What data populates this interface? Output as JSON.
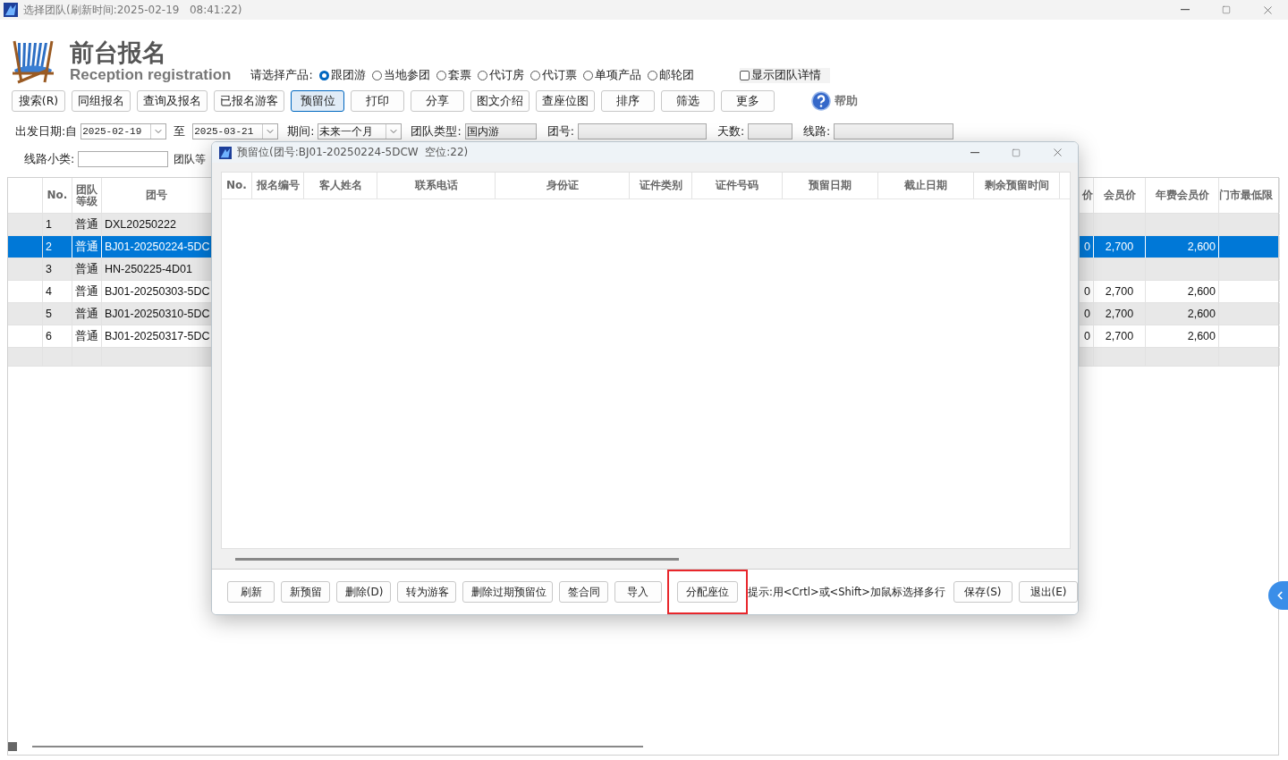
{
  "window": {
    "title": "选择团队(刷新时间:2025-02-19   08:41:22)"
  },
  "header": {
    "title": "前台报名",
    "subtitle": "Reception registration"
  },
  "product": {
    "label": "请选择产品:",
    "options": [
      {
        "label": "跟团游",
        "selected": true
      },
      {
        "label": "当地参团",
        "selected": false
      },
      {
        "label": "套票",
        "selected": false
      },
      {
        "label": "代订房",
        "selected": false
      },
      {
        "label": "代订票",
        "selected": false
      },
      {
        "label": "单项产品",
        "selected": false
      },
      {
        "label": "邮轮团",
        "selected": false
      }
    ],
    "detail_checkbox": {
      "label": "显示团队详情",
      "checked": false
    }
  },
  "toolbar": [
    {
      "label": "搜索(R)",
      "selected": false
    },
    {
      "label": "同组报名",
      "selected": false
    },
    {
      "label": "查询及报名",
      "selected": false
    },
    {
      "label": "已报名游客",
      "selected": false
    },
    {
      "label": "预留位",
      "selected": true
    },
    {
      "label": "打印",
      "selected": false
    },
    {
      "label": "分享",
      "selected": false
    },
    {
      "label": "图文介绍",
      "selected": false
    },
    {
      "label": "查座位图",
      "selected": false
    },
    {
      "label": "排序",
      "selected": false
    },
    {
      "label": "筛选",
      "selected": false
    },
    {
      "label": "更多",
      "selected": false
    }
  ],
  "help": "帮助",
  "filters": {
    "date_label": "出发日期:自",
    "date_from": "2025-02-19",
    "to_label": "至",
    "date_to": "2025-03-21",
    "period_label": "期间:",
    "period": "未来一个月",
    "type_label": "团队类型:",
    "type": "国内游",
    "group_label": "团号:",
    "days_label": "天数:",
    "route_label": "线路:",
    "subclass_label": "线路小类:",
    "level_label": "团队等"
  },
  "grid": {
    "columns": [
      "No.",
      "团队等级",
      "团号",
      "价",
      "会员价",
      "年费会员价",
      "门市最低限"
    ],
    "rows": [
      {
        "no": "1",
        "grade": "普通",
        "group": "DXL20250222",
        "selected": false
      },
      {
        "no": "2",
        "grade": "普通",
        "group": "BJ01-20250224-5DC",
        "price_tail": "0",
        "member_price": "2,700",
        "annual_price": "2,600",
        "selected": true
      },
      {
        "no": "3",
        "grade": "普通",
        "group": "HN-250225-4D01",
        "selected": false
      },
      {
        "no": "4",
        "grade": "普通",
        "group": "BJ01-20250303-5DC",
        "price_tail": "0",
        "member_price": "2,700",
        "annual_price": "2,600",
        "selected": false
      },
      {
        "no": "5",
        "grade": "普通",
        "group": "BJ01-20250310-5DC",
        "price_tail": "0",
        "member_price": "2,700",
        "annual_price": "2,600",
        "selected": false
      },
      {
        "no": "6",
        "grade": "普通",
        "group": "BJ01-20250317-5DC",
        "price_tail": "0",
        "member_price": "2,700",
        "annual_price": "2,600",
        "selected": false
      }
    ]
  },
  "dialog": {
    "title": "预留位(团号:BJ01-20250224-5DCW  空位:22)",
    "columns": [
      "No.",
      "报名编号",
      "客人姓名",
      "联系电话",
      "身份证",
      "证件类别",
      "证件号码",
      "预留日期",
      "截止日期",
      "剩余预留时间"
    ],
    "buttons": [
      {
        "label": "刷新",
        "highlighted": false
      },
      {
        "label": "新预留",
        "highlighted": false
      },
      {
        "label": "删除(D)",
        "highlighted": false
      },
      {
        "label": "转为游客",
        "highlighted": false
      },
      {
        "label": "删除过期预留位",
        "highlighted": false
      },
      {
        "label": "签合同",
        "highlighted": false
      },
      {
        "label": "导入",
        "highlighted": false
      },
      {
        "label": "分配座位",
        "highlighted": true
      }
    ],
    "hint": "提示:用<Crtl>或<Shift>加鼠标选择多行",
    "end_buttons": [
      "保存(S)",
      "退出(E)"
    ]
  }
}
